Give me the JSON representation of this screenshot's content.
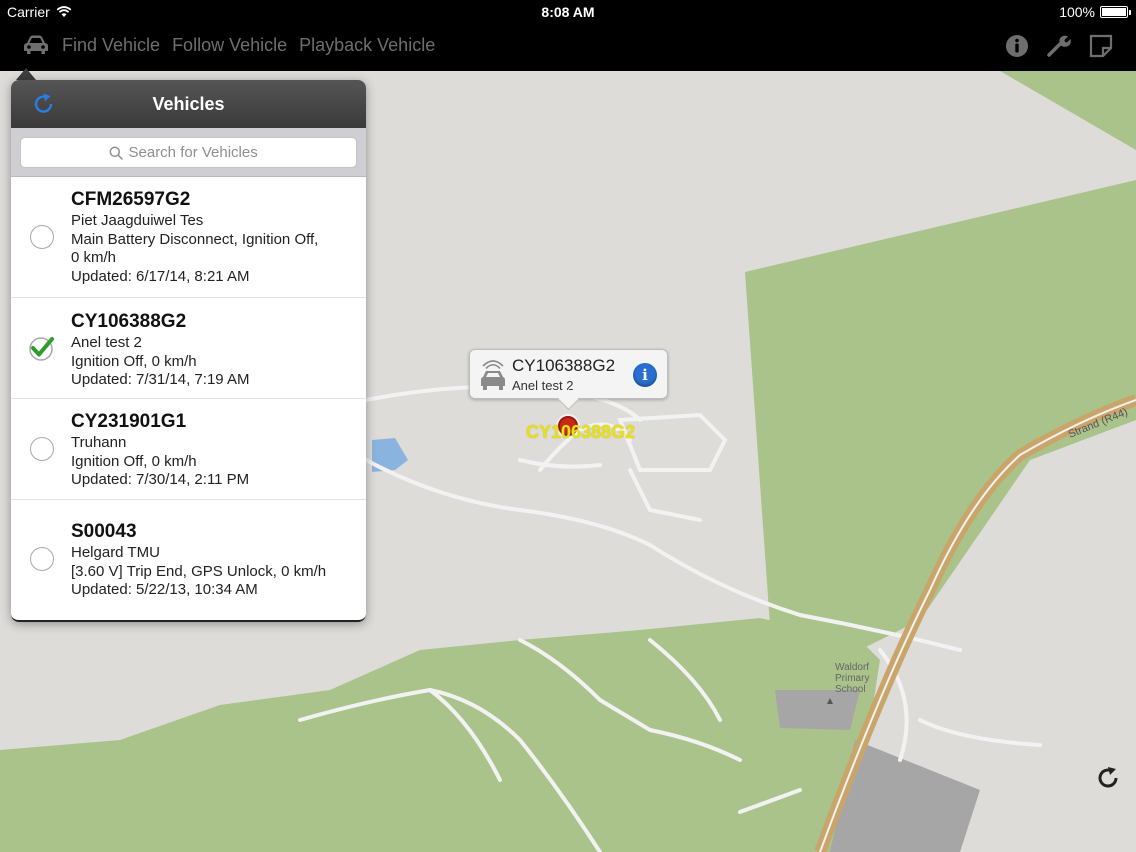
{
  "status_bar": {
    "carrier": "Carrier",
    "time": "8:08 AM",
    "battery": "100%"
  },
  "toolbar": {
    "tabs": [
      "Find Vehicle",
      "Follow Vehicle",
      "Playback Vehicle"
    ],
    "right_icons": [
      "info-icon",
      "wrench-icon",
      "note-icon"
    ]
  },
  "panel": {
    "title": "Vehicles",
    "search_placeholder": "Search for Vehicles",
    "vehicles": [
      {
        "id": "CFM26597G2",
        "lines": [
          "Piet Jaagduiwel  Tes",
          "Main Battery Disconnect, Ignition Off,",
          "0 km/h",
          "Updated: 6/17/14, 8:21 AM"
        ],
        "selected": false
      },
      {
        "id": "CY106388G2",
        "lines": [
          "Anel test 2",
          "Ignition Off, 0 km/h",
          "Updated: 7/31/14, 7:19 AM"
        ],
        "selected": true
      },
      {
        "id": "CY231901G1",
        "lines": [
          "Truhann",
          "Ignition Off, 0 km/h",
          "Updated: 7/30/14, 2:11 PM"
        ],
        "selected": false
      },
      {
        "id": "S00043",
        "lines": [
          "Helgard TMU",
          "[3.60 V] Trip End, GPS Unlock, 0 km/h",
          "Updated: 5/22/13, 10:34 AM"
        ],
        "selected": false
      }
    ]
  },
  "map": {
    "callout": {
      "title": "CY106388G2",
      "subtitle": "Anel test 2"
    },
    "marker_label": "CY106388G2",
    "road_label": "Strand (R44)",
    "poi_label": [
      "Waldorf",
      "Primary",
      "School"
    ]
  },
  "colors": {
    "accent": "#2a7de1",
    "marker": "#c8291a",
    "label": "#e8e01a",
    "park": "#a9c38a",
    "road": "#c9a56a"
  }
}
